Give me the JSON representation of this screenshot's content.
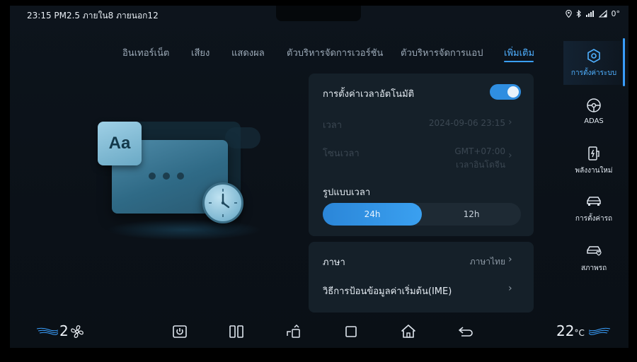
{
  "status_bar": {
    "left_text": "23:15 PM2.5 ภายใน8 ภายนอก12",
    "right_text": "0°",
    "icons": [
      "location-icon",
      "bluetooth-icon",
      "signal-icon",
      "network-icon"
    ]
  },
  "tabs": [
    {
      "label": "อินเทอร์เน็ต",
      "active": false
    },
    {
      "label": "เสียง",
      "active": false
    },
    {
      "label": "แสดงผล",
      "active": false
    },
    {
      "label": "ตัวบริหารจัดการเวอร์ชัน",
      "active": false
    },
    {
      "label": "ตัวบริหารจัดการแอป",
      "active": false
    },
    {
      "label": "เพิ่มเติม",
      "active": true
    }
  ],
  "illustration": {
    "badge_text": "Aa"
  },
  "time_settings": {
    "auto_time_label": "การตั้งค่าเวลาอัตโนมัติ",
    "auto_time_enabled": true,
    "time_label": "เวลา",
    "time_value": "2024-09-06 23:15",
    "timezone_label": "โซนเวลา",
    "timezone_value_line1": "GMT+07:00",
    "timezone_value_line2": "เวลาอินโดจีน",
    "format_label": "รูปแบบเวลา",
    "format_options": [
      "24h",
      "12h"
    ],
    "format_selected": "24h"
  },
  "language_settings": {
    "language_label": "ภาษา",
    "language_value": "ภาษาไทย",
    "ime_label": "วิธีการป้อนข้อมูลค่าเริ่มต้น(IME)"
  },
  "sidebar": {
    "items": [
      {
        "label": "การตั้งค่าระบบ",
        "icon": "hexagon-settings-icon",
        "active": true
      },
      {
        "label": "ADAS",
        "icon": "steering-wheel-icon",
        "active": false
      },
      {
        "label": "พลังงานใหม่",
        "icon": "charging-station-icon",
        "active": false
      },
      {
        "label": "การตั้งค่ารถ",
        "icon": "car-icon",
        "active": false
      },
      {
        "label": "สภาพรถ",
        "icon": "car-health-icon",
        "active": false
      }
    ]
  },
  "bottom_bar": {
    "fan_level": "2",
    "temperature": "22",
    "temperature_unit": "°C",
    "icons": [
      "fan-icon",
      "power-icon",
      "split-screen-icon",
      "app-drawer-icon",
      "recents-icon",
      "home-icon",
      "back-icon"
    ]
  },
  "colors": {
    "accent": "#3aa0ff",
    "background": "#0d141c",
    "card": "#152029"
  }
}
